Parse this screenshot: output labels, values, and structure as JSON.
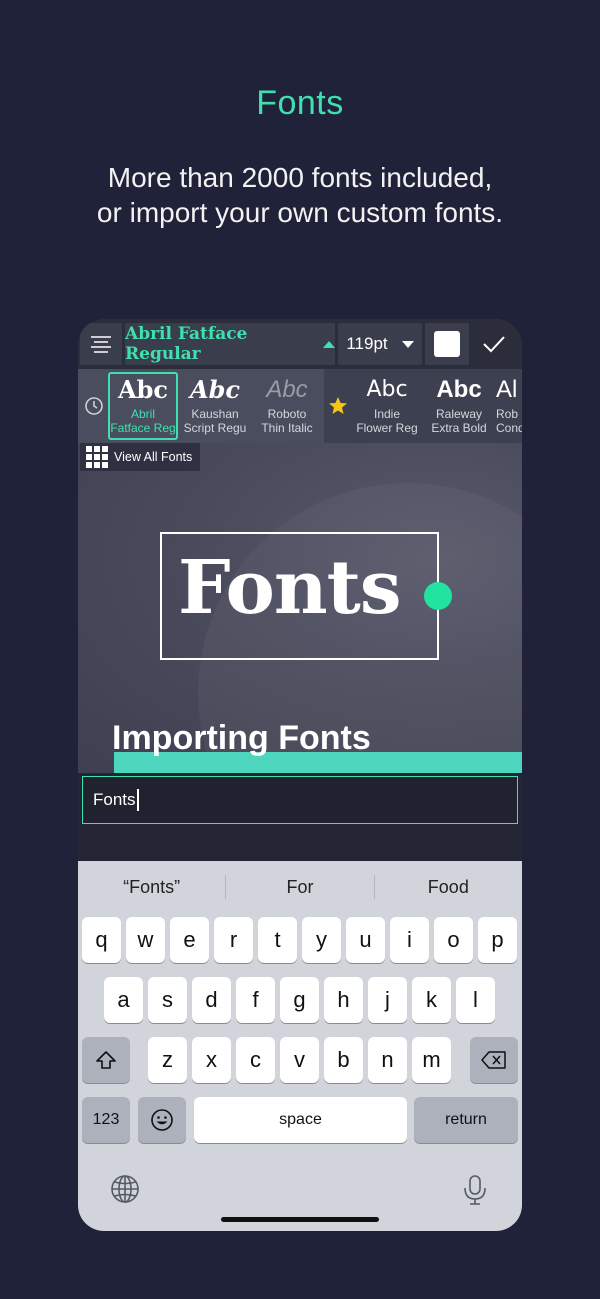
{
  "promo": {
    "title": "Fonts",
    "subtitle_line1": "More than 2000 fonts included,",
    "subtitle_line2": "or import your own custom fonts."
  },
  "toolbar": {
    "font_name": "Abril Fatface Regular",
    "font_size": "119pt",
    "text_color": "#ffffff"
  },
  "font_strip": {
    "recent_fonts": [
      {
        "sample": "Abc",
        "name_line1": "Abril",
        "name_line2": "Fatface Reg",
        "selected": true
      },
      {
        "sample": "Abc",
        "name_line1": "Kaushan",
        "name_line2": "Script Regu",
        "selected": false
      },
      {
        "sample": "Abc",
        "name_line1": "Roboto",
        "name_line2": "Thin Italic",
        "selected": false
      }
    ],
    "favorite_fonts": [
      {
        "sample": "Abc",
        "name_line1": "Indie",
        "name_line2": "Flower Reg"
      },
      {
        "sample": "Abc",
        "name_line1": "Raleway",
        "name_line2": "Extra Bold"
      },
      {
        "sample": "Al",
        "name_line1": "Rob",
        "name_line2": "Cond"
      }
    ],
    "view_all_label": "View All Fonts"
  },
  "canvas": {
    "main_text": "Fonts",
    "secondary_text": "Importing Fonts"
  },
  "text_input": {
    "value": "Fonts"
  },
  "keyboard": {
    "suggestions": [
      "“Fonts”",
      "For",
      "Food"
    ],
    "row1": [
      "q",
      "w",
      "e",
      "r",
      "t",
      "y",
      "u",
      "i",
      "o",
      "p"
    ],
    "row2": [
      "a",
      "s",
      "d",
      "f",
      "g",
      "h",
      "j",
      "k",
      "l"
    ],
    "row3": [
      "z",
      "x",
      "c",
      "v",
      "b",
      "n",
      "m"
    ],
    "numbers_key": "123",
    "space_key": "space",
    "return_key": "return"
  },
  "colors": {
    "accent": "#3ee0b0",
    "background": "#1f2238",
    "handle": "#22e39f",
    "teal_bar": "#4dd6bd"
  }
}
